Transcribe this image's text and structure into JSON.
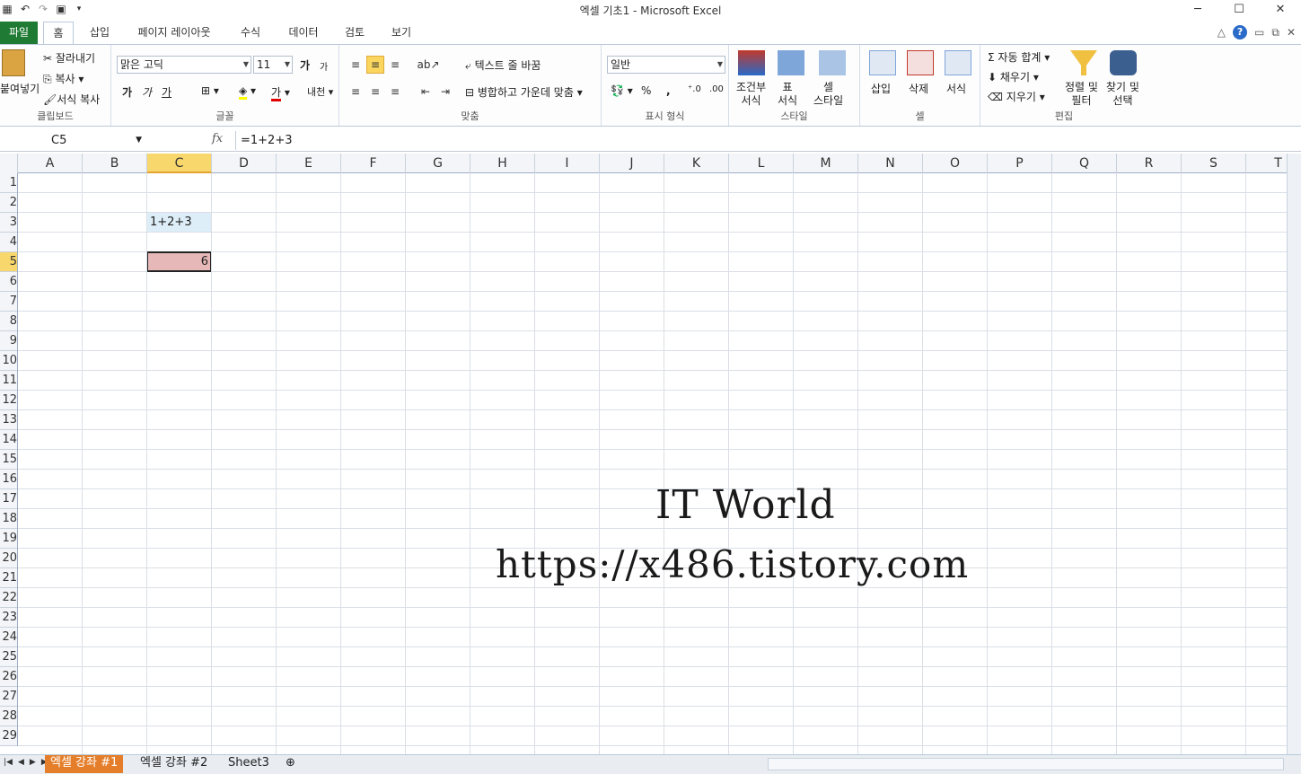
{
  "window": {
    "title": "엑셀 기초1  -  Microsoft Excel",
    "minimize": "─",
    "maximize": "☐",
    "close": "✕"
  },
  "tabs": {
    "file": "파일",
    "home": "홈",
    "insert": "삽입",
    "page_layout": "페이지 레이아웃",
    "formulas": "수식",
    "data": "데이터",
    "review": "검토",
    "view": "보기"
  },
  "ribbon": {
    "clipboard": {
      "label": "클립보드",
      "paste": "붙여넣기",
      "cut": "잘라내기",
      "copy": "복사",
      "format_painter": "서식 복사"
    },
    "font": {
      "label": "글꼴",
      "name": "맑은 고딕",
      "size": "11",
      "bold": "가",
      "italic": "가",
      "underline": "가",
      "grow": "가",
      "shrink": "가",
      "font_color": "가",
      "phonetic": "내천"
    },
    "alignment": {
      "label": "맞춤",
      "wrap": "텍스트 줄 바꿈",
      "merge": "병합하고 가운데 맞춤"
    },
    "number": {
      "label": "표시 형식",
      "format": "일반",
      "percent": "%",
      "comma": ","
    },
    "styles": {
      "label": "스타일",
      "conditional": "조건부\n서식",
      "table": "표\n서식",
      "cell_styles": "셀\n스타일"
    },
    "cells": {
      "label": "셀",
      "insert": "삽입",
      "delete": "삭제",
      "format": "서식"
    },
    "editing": {
      "label": "편집",
      "autosum": "자동 합계",
      "fill": "채우기",
      "clear": "지우기",
      "sort": "정렬 및\n필터",
      "find": "찾기 및\n선택"
    }
  },
  "formula_bar": {
    "name_box": "C5",
    "fx": "fx",
    "formula": "=1+2+3"
  },
  "columns": [
    "A",
    "B",
    "C",
    "D",
    "E",
    "F",
    "G",
    "H",
    "I",
    "J",
    "K",
    "L",
    "M",
    "N",
    "O",
    "P",
    "Q",
    "R",
    "S",
    "T"
  ],
  "rows": [
    "1",
    "2",
    "3",
    "4",
    "5",
    "6",
    "7",
    "8",
    "9",
    "10",
    "11",
    "12",
    "13",
    "14",
    "15",
    "16",
    "17",
    "18",
    "19",
    "20",
    "21",
    "22",
    "23",
    "24",
    "25",
    "26",
    "27",
    "28",
    "29"
  ],
  "cells": {
    "c3": "1+2+3",
    "c5": "6"
  },
  "watermark": {
    "line1": "IT World",
    "line2": "https://x486.tistory.com"
  },
  "sheets": [
    "엑셀 강좌 #1",
    "엑셀 강좌 #2",
    "Sheet3"
  ],
  "colors": {
    "active_sheet": "#e57e2a",
    "file_tab": "#1f7a33",
    "selected_header": "#f8d76c",
    "c3_fill": "#ddeef8",
    "c5_fill": "#e6b8b7"
  }
}
